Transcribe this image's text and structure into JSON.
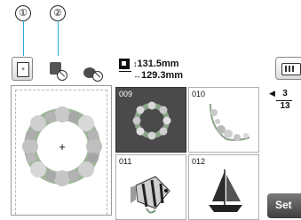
{
  "callouts": [
    "①",
    "②"
  ],
  "size": {
    "height_label": "131.5mm",
    "width_label": "129.3mm"
  },
  "tiles": [
    {
      "number": "009",
      "selected": true,
      "icon": "flower-wreath"
    },
    {
      "number": "010",
      "selected": false,
      "icon": "floral-corner"
    },
    {
      "number": "011",
      "selected": false,
      "icon": "fish"
    },
    {
      "number": "012",
      "selected": false,
      "icon": "sailboat"
    }
  ],
  "pagination": {
    "current": "3",
    "total": "13"
  },
  "set_button": "Set",
  "colors": {
    "accent_line": "#2aa6d8",
    "selected_tile": "#4a4a4a"
  }
}
